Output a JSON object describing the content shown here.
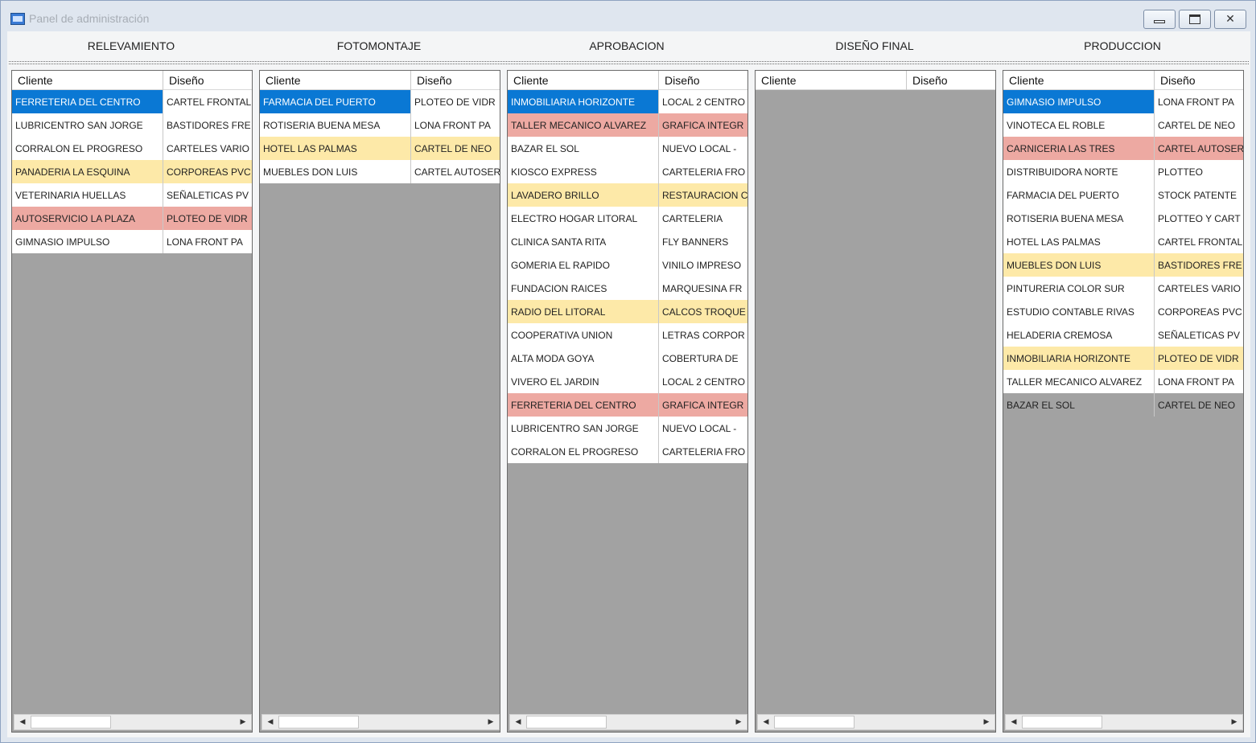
{
  "window": {
    "title": "Panel de administración",
    "icon": "app-icon",
    "controls": [
      "minimize-icon",
      "maximize-icon",
      "close-icon"
    ]
  },
  "tabs": [
    "RELEVAMIENTO",
    "FOTOMONTAJE",
    "APROBACION",
    "DISEÑO FINAL",
    "PRODUCCION"
  ],
  "columns": [
    "Cliente",
    "Diseño"
  ],
  "colors": {
    "selected": "#0a78d4",
    "yellow": "#fde9a8",
    "red": "#eda9a2",
    "empty_area": "#a2a2a2"
  },
  "panels": [
    {
      "stage": "RELEVAMIENTO",
      "rows": [
        {
          "cliente": "FERRETERIA DEL CENTRO",
          "diseno": "CARTEL FRONTAL",
          "state": "sel"
        },
        {
          "cliente": "LUBRICENTRO SAN JORGE",
          "diseno": "BASTIDORES FRE",
          "state": ""
        },
        {
          "cliente": "CORRALON EL PROGRESO",
          "diseno": "CARTELES VARIO",
          "state": ""
        },
        {
          "cliente": "PANADERIA LA ESQUINA",
          "diseno": "CORPOREAS PVC",
          "state": "yellow"
        },
        {
          "cliente": "VETERINARIA HUELLAS",
          "diseno": "SEÑALETICAS PV",
          "state": ""
        },
        {
          "cliente": "AUTOSERVICIO LA PLAZA",
          "diseno": "PLOTEO DE VIDR",
          "state": "red"
        },
        {
          "cliente": "GIMNASIO IMPULSO",
          "diseno": "LONA FRONT PA",
          "state": ""
        }
      ]
    },
    {
      "stage": "FOTOMONTAJE",
      "rows": [
        {
          "cliente": "FARMACIA DEL PUERTO",
          "diseno": "PLOTEO DE VIDR",
          "state": "sel"
        },
        {
          "cliente": "ROTISERIA BUENA MESA",
          "diseno": "LONA FRONT PA",
          "state": ""
        },
        {
          "cliente": "HOTEL LAS PALMAS",
          "diseno": "CARTEL DE NEO",
          "state": "yellow"
        },
        {
          "cliente": "MUEBLES DON LUIS",
          "diseno": "CARTEL AUTOSER",
          "state": ""
        }
      ]
    },
    {
      "stage": "APROBACION",
      "rows": [
        {
          "cliente": "INMOBILIARIA HORIZONTE",
          "diseno": "LOCAL 2 CENTRO",
          "state": "sel"
        },
        {
          "cliente": "TALLER MECANICO ALVAREZ",
          "diseno": "GRAFICA INTEGR",
          "state": "red"
        },
        {
          "cliente": "BAZAR EL SOL",
          "diseno": "NUEVO LOCAL -",
          "state": ""
        },
        {
          "cliente": "KIOSCO EXPRESS",
          "diseno": "CARTELERIA FRO",
          "state": ""
        },
        {
          "cliente": "LAVADERO BRILLO",
          "diseno": "RESTAURACION CA",
          "state": "yellow"
        },
        {
          "cliente": "ELECTRO HOGAR LITORAL",
          "diseno": "CARTELERIA",
          "state": ""
        },
        {
          "cliente": "CLINICA SANTA RITA",
          "diseno": "FLY BANNERS",
          "state": ""
        },
        {
          "cliente": "GOMERIA EL RAPIDO",
          "diseno": "VINILO IMPRESO",
          "state": ""
        },
        {
          "cliente": "FUNDACION RAICES",
          "diseno": "MARQUESINA FR",
          "state": ""
        },
        {
          "cliente": "RADIO DEL LITORAL",
          "diseno": "CALCOS TROQUE",
          "state": "yellow"
        },
        {
          "cliente": "COOPERATIVA UNION",
          "diseno": "LETRAS CORPOR",
          "state": ""
        },
        {
          "cliente": "ALTA MODA GOYA",
          "diseno": "COBERTURA DE",
          "state": ""
        },
        {
          "cliente": "VIVERO EL JARDIN",
          "diseno": "LOCAL 2 CENTRO",
          "state": ""
        },
        {
          "cliente": "FERRETERIA DEL CENTRO",
          "diseno": "GRAFICA INTEGR",
          "state": "red"
        },
        {
          "cliente": "LUBRICENTRO SAN JORGE",
          "diseno": "NUEVO LOCAL -",
          "state": ""
        },
        {
          "cliente": "CORRALON EL PROGRESO",
          "diseno": "CARTELERIA FRO",
          "state": ""
        }
      ]
    },
    {
      "stage": "DISEÑO FINAL",
      "rows": []
    },
    {
      "stage": "PRODUCCION",
      "rows": [
        {
          "cliente": "GIMNASIO IMPULSO",
          "diseno": "LONA FRONT PA",
          "state": "sel"
        },
        {
          "cliente": "VINOTECA EL ROBLE",
          "diseno": "CARTEL DE NEO",
          "state": ""
        },
        {
          "cliente": "CARNICERIA LAS TRES",
          "diseno": "CARTEL AUTOSER",
          "state": "red"
        },
        {
          "cliente": "DISTRIBUIDORA NORTE",
          "diseno": "PLOTTEO",
          "state": ""
        },
        {
          "cliente": "FARMACIA DEL PUERTO",
          "diseno": "STOCK PATENTE",
          "state": ""
        },
        {
          "cliente": "ROTISERIA BUENA MESA",
          "diseno": "PLOTTEO Y CART",
          "state": ""
        },
        {
          "cliente": "HOTEL LAS PALMAS",
          "diseno": "CARTEL FRONTAL",
          "state": ""
        },
        {
          "cliente": "MUEBLES DON LUIS",
          "diseno": "BASTIDORES FRE",
          "state": "yellow"
        },
        {
          "cliente": "PINTURERIA COLOR SUR",
          "diseno": "CARTELES VARIO",
          "state": ""
        },
        {
          "cliente": "ESTUDIO CONTABLE RIVAS",
          "diseno": "CORPOREAS PVC",
          "state": ""
        },
        {
          "cliente": "HELADERIA CREMOSA",
          "diseno": "SEÑALETICAS PV",
          "state": ""
        },
        {
          "cliente": "INMOBILIARIA HORIZONTE",
          "diseno": "PLOTEO DE VIDR",
          "state": "yellow"
        },
        {
          "cliente": "TALLER MECANICO ALVAREZ",
          "diseno": "LONA FRONT PA",
          "state": ""
        },
        {
          "cliente": "BAZAR EL SOL",
          "diseno": "CARTEL DE NEO",
          "state": "grey"
        }
      ]
    }
  ]
}
